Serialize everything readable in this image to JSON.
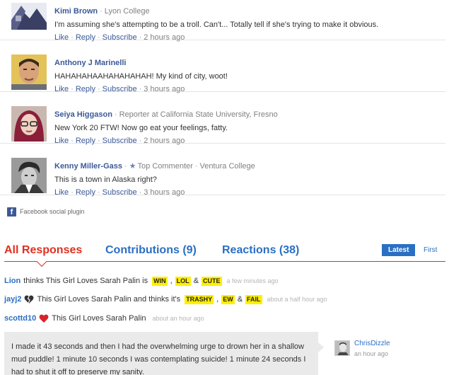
{
  "comments": [
    {
      "name": "Kimi Brown",
      "affiliation": "Lyon College",
      "badge": "",
      "text": "I'm assuming she's attempting to be a troll. Can't... Totally tell if she's trying to make it obvious.",
      "actions": {
        "like": "Like",
        "reply": "Reply",
        "subscribe": "Subscribe"
      },
      "time": "2 hours ago",
      "avatar": "kimi-avatar"
    },
    {
      "name": "Anthony J Marinelli",
      "affiliation": "",
      "badge": "",
      "text": "HAHAHAHAAHAHAHAHAH! My kind of city, woot!",
      "actions": {
        "like": "Like",
        "reply": "Reply",
        "subscribe": "Subscribe"
      },
      "time": "3 hours ago",
      "avatar": "anthony-avatar"
    },
    {
      "name": "Seiya Higgason",
      "affiliation": "Reporter at California State University, Fresno",
      "badge": "",
      "text": "New York 20 FTW! Now go eat your feelings, fatty.",
      "actions": {
        "like": "Like",
        "reply": "Reply",
        "subscribe": "Subscribe"
      },
      "time": "2 hours ago",
      "avatar": "seiya-avatar"
    },
    {
      "name": "Kenny Miller-Gass",
      "affiliation": "Ventura College",
      "badge": "Top Commenter",
      "text": "This is a town in Alaska right?",
      "actions": {
        "like": "Like",
        "reply": "Reply",
        "subscribe": "Subscribe"
      },
      "time": "3 hours ago",
      "avatar": "kenny-avatar"
    }
  ],
  "fb_plugin": {
    "label": "Facebook social plugin",
    "logo": "f"
  },
  "tabs": {
    "all": "All Responses",
    "contributions": "Contributions (9)",
    "reactions": "Reactions (38)"
  },
  "sort": {
    "latest": "Latest",
    "first": "First"
  },
  "reactions": [
    {
      "user": "Lion",
      "text": "thinks This Girl Loves Sarah Palin is",
      "tags": [
        "WIN",
        "LOL",
        "CUTE"
      ],
      "time": "a few minutes ago",
      "icon": ""
    },
    {
      "user": "jayj2",
      "text": "This Girl Loves Sarah Palin and thinks it's",
      "tags": [
        "TRASHY",
        "EW",
        "FAIL"
      ],
      "time": "about a half hour ago",
      "icon": "broken-heart-icon"
    },
    {
      "user": "scottd10",
      "text": "This Girl Loves Sarah Palin",
      "tags": [],
      "time": "about an hour ago",
      "icon": "heart-icon"
    }
  ],
  "featured_comment": {
    "text": "I made it 43 seconds and then I had the overwhelming urge to drown her in a shallow mud puddle! 1 minute 10 seconds I was contemplating suicide! 1 minute 24 seconds I had to shut it off to preserve my sanity.",
    "author": "ChrisDizzle",
    "time": "an hour ago"
  },
  "colors": {
    "fb_link": "#3b5998",
    "accent_red": "#e03020",
    "accent_blue": "#2a6fc4",
    "tag_yellow": "#ffef00",
    "bubble_gray": "#eaeaea"
  }
}
